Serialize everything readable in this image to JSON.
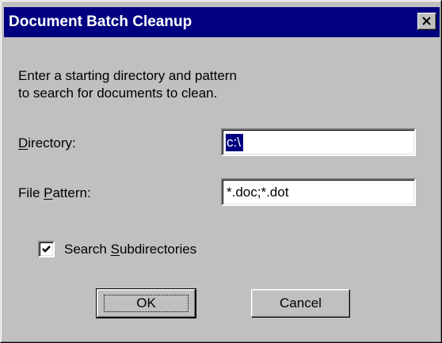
{
  "window": {
    "title": "Document Batch Cleanup",
    "close_icon": "close-x-icon"
  },
  "instructions": {
    "line1": "Enter a starting directory and pattern",
    "line2": "to search for documents to clean."
  },
  "directory": {
    "label_before": "",
    "label_mnemonic": "D",
    "label_after": "irectory:",
    "value": "c:\\"
  },
  "file_pattern": {
    "label_before": "File ",
    "label_mnemonic": "P",
    "label_after": "attern:",
    "value": "*.doc;*.dot"
  },
  "search_subdirectories": {
    "label_before": "Search ",
    "label_mnemonic": "S",
    "label_after": "ubdirectories",
    "checked": true
  },
  "buttons": {
    "ok_label": "OK",
    "cancel_label": "Cancel"
  },
  "colors": {
    "titlebar": "#000080",
    "dialog_face": "#c0c0c0",
    "selection": "#000080"
  }
}
